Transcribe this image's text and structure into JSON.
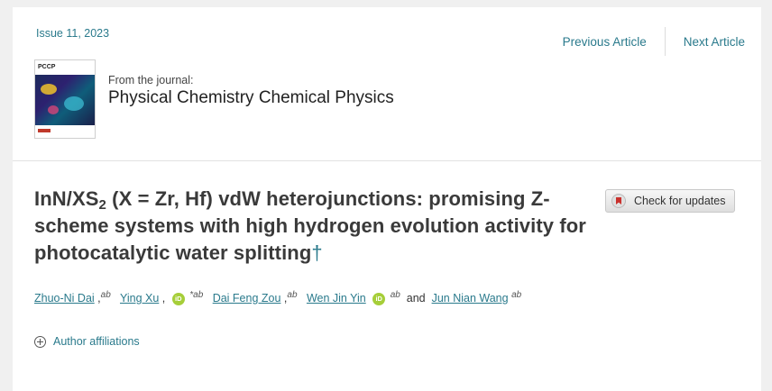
{
  "header": {
    "issue": "Issue 11, 2023",
    "prev_label": "Previous Article",
    "next_label": "Next Article"
  },
  "journal": {
    "cover_label": "PCCP",
    "from_label": "From the journal:",
    "name": "Physical Chemistry Chemical Physics"
  },
  "article": {
    "title_part1": "InN/XS",
    "title_sub": "2",
    "title_part2": " (X = Zr, Hf) vdW heterojunctions: promising Z-scheme systems with high hydrogen evolution activity for photocatalytic water splitting",
    "dagger": "†",
    "check_updates_label": "Check for updates"
  },
  "authors": [
    {
      "name": "Zhuo-Ni Dai",
      "sup": "ab",
      "sep": ","
    },
    {
      "name": "Ying Xu",
      "sup": "*ab",
      "sep": ",",
      "orcid": "iD"
    },
    {
      "name": "Dai Feng Zou",
      "sup": "ab",
      "sep": ","
    },
    {
      "name": "Wen Jin Yin",
      "sup": "ab",
      "orcid": "iD"
    },
    {
      "and": "and"
    },
    {
      "name": "Jun Nian Wang",
      "sup": "ab"
    }
  ],
  "affiliations_label": "Author affiliations",
  "colors": {
    "link": "#2a7a8c",
    "title": "#3a3a3a",
    "orcid": "#a6ce39"
  }
}
